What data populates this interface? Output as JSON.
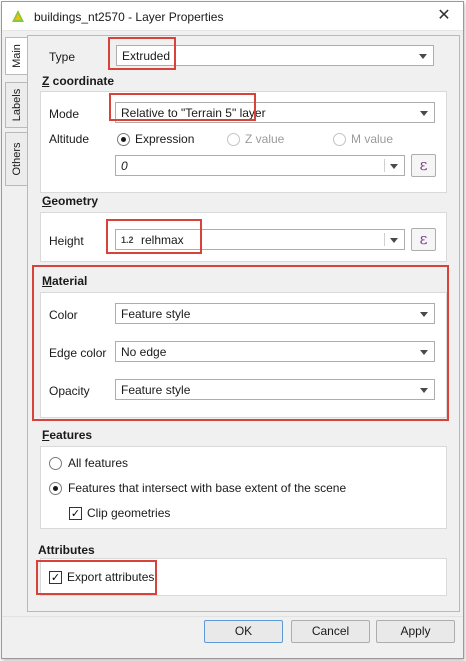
{
  "window": {
    "title": "buildings_nt2570 - Layer Properties",
    "close_glyph": "✕"
  },
  "tabs": [
    {
      "label": "Main"
    },
    {
      "label": "Labels"
    },
    {
      "label": "Others"
    }
  ],
  "type_row": {
    "label": "Type",
    "value": "Extruded"
  },
  "z_coordinate": {
    "title": "Z coordinate",
    "mode_label": "Mode",
    "mode_value": "Relative to \"Terrain 5\" layer",
    "altitude_label": "Altitude",
    "options": [
      {
        "label": "Expression",
        "selected": true,
        "enabled": true
      },
      {
        "label": "Z value",
        "selected": false,
        "enabled": false
      },
      {
        "label": "M value",
        "selected": false,
        "enabled": false
      }
    ],
    "expression_value": "0",
    "expression_button": "ε"
  },
  "geometry": {
    "title": "Geometry",
    "height_label": "Height",
    "height_type_badge": "1.2",
    "height_value": "relhmax",
    "expression_button": "ε"
  },
  "material": {
    "title": "Material",
    "color_label": "Color",
    "color_value": "Feature style",
    "edge_label": "Edge color",
    "edge_value": "No edge",
    "opacity_label": "Opacity",
    "opacity_value": "Feature style"
  },
  "features": {
    "title": "Features",
    "all_label": "All features",
    "intersect_label": "Features that intersect with base extent of the scene",
    "clip_label": "Clip geometries",
    "clip_checked": true,
    "check_glyph": "✓"
  },
  "attributes": {
    "title": "Attributes",
    "export_label": "Export attributes",
    "export_checked": true
  },
  "buttons": {
    "ok": "OK",
    "cancel": "Cancel",
    "apply": "Apply"
  },
  "colors": {
    "highlight": "#d9423a",
    "expression_icon": "#7a3d8c",
    "app_icon_green": "#8cc63f",
    "app_icon_yellow": "#f2c200"
  }
}
